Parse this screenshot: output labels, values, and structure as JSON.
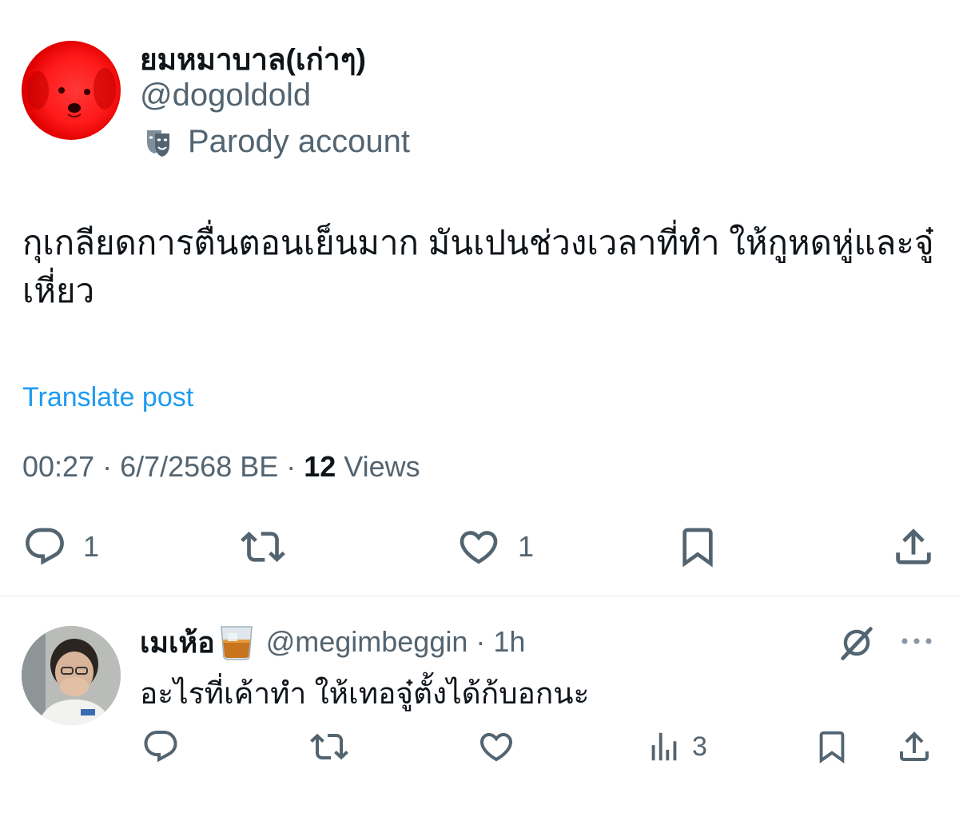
{
  "post": {
    "author_name": "ยมหมาบาล(เก่าๆ)",
    "author_handle": "@dogoldold",
    "parody_label": "Parody account",
    "text": "กุเกลียดการตื่นตอนเย็นมาก มันเปนช่วงเวลาที่ทำ ให้กูหดหู่และจู๋เหี่ยว",
    "translate_label": "Translate post",
    "time": "00:27 · 6/7/2568 BE · ",
    "views_count": "12",
    "views_label": " Views",
    "actions": {
      "reply_count": "1",
      "like_count": "1"
    }
  },
  "reply": {
    "author_name": "เมเห้อ",
    "emoji": "whisky-glass-emoji",
    "author_handle": "@megimbeggin · 1h",
    "text": "อะไรที่เค้าทำ ให้เทอจู๋ตั้งได้ก้บอกนะ",
    "views_count": "3"
  },
  "colors": {
    "text": "#0f1419",
    "secondary": "#536471",
    "link": "#1d9bf0",
    "divider": "#e1e5e8"
  }
}
